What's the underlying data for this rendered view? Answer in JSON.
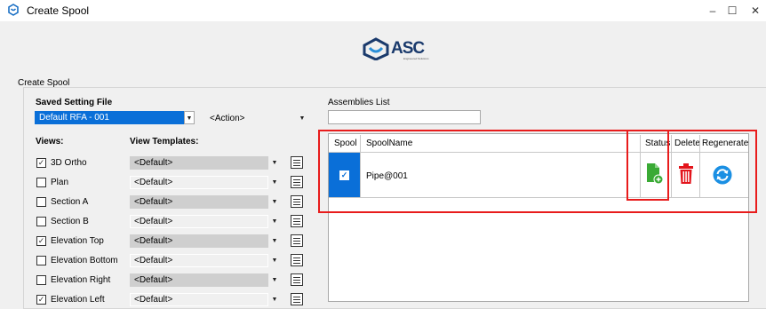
{
  "window": {
    "title": "Create Spool",
    "minimize_glyph": "–",
    "maximize_glyph": "☐",
    "close_glyph": "✕"
  },
  "logo": {
    "text": "ASC",
    "tagline": "Engineered Solutions"
  },
  "section_title": "Create Spool",
  "saved_setting": {
    "label": "Saved Setting File",
    "selected": "Default RFA - 001",
    "action_selected": "<Action>"
  },
  "views": {
    "views_label": "Views:",
    "templates_label": "View Templates:",
    "items": [
      {
        "label": "3D Ortho",
        "checked": true,
        "template": "<Default>",
        "template_disabled": true
      },
      {
        "label": "Plan",
        "checked": false,
        "template": "<Default>",
        "template_disabled": false
      },
      {
        "label": "Section A",
        "checked": false,
        "template": "<Default>",
        "template_disabled": true
      },
      {
        "label": "Section B",
        "checked": false,
        "template": "<Default>",
        "template_disabled": false
      },
      {
        "label": "Elevation Top",
        "checked": true,
        "template": "<Default>",
        "template_disabled": true
      },
      {
        "label": "Elevation Bottom",
        "checked": false,
        "template": "<Default>",
        "template_disabled": false
      },
      {
        "label": "Elevation Right",
        "checked": false,
        "template": "<Default>",
        "template_disabled": true
      },
      {
        "label": "Elevation Left",
        "checked": true,
        "template": "<Default>",
        "template_disabled": false
      }
    ]
  },
  "assemblies": {
    "label": "Assemblies List",
    "search_value": "",
    "columns": [
      "Spool",
      "SpoolName",
      "Status",
      "Delete",
      "Regenerate"
    ],
    "rows": [
      {
        "spool_checked": true,
        "name": "Pipe@001"
      }
    ]
  },
  "colors": {
    "highlight": "#0a6fd8",
    "annotation_red": "#e81c1c",
    "status_green": "#3aaa35",
    "delete_red": "#e3141b",
    "regenerate_blue": "#1a8fe3"
  }
}
